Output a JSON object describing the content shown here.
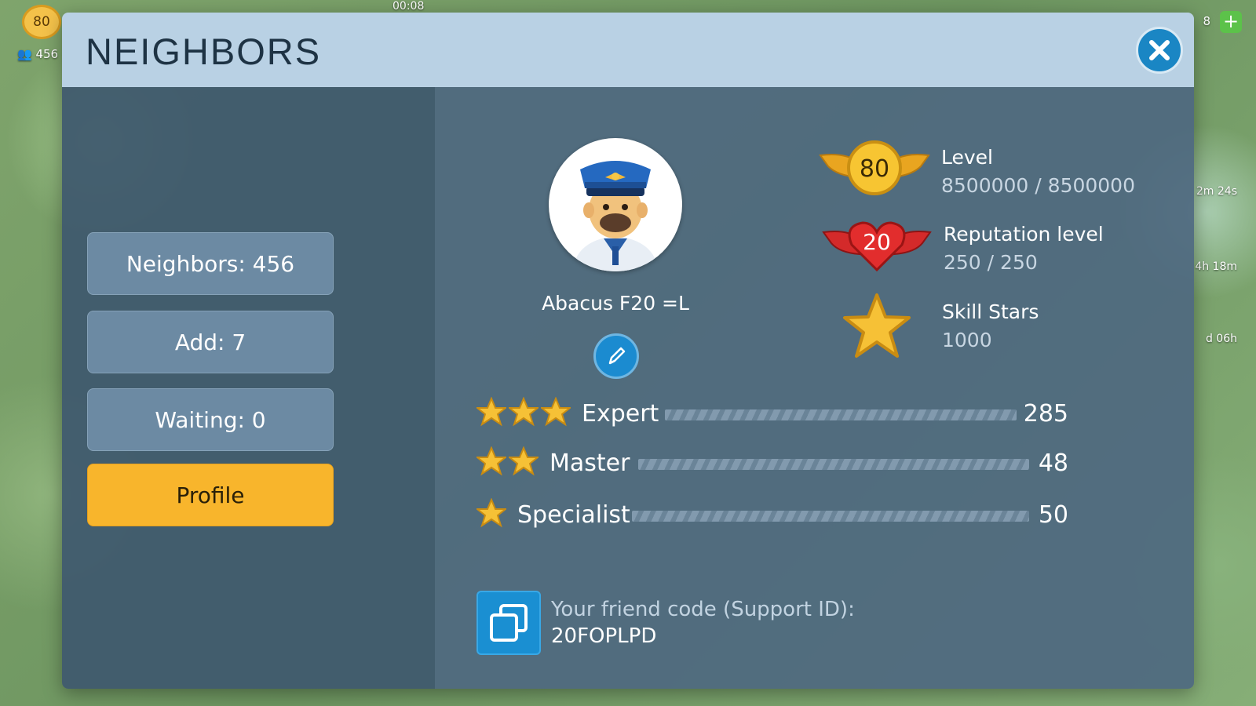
{
  "hud": {
    "level": "80",
    "population": "456",
    "time": "00:08",
    "right_counter": "8",
    "timers": [
      "2m 24s",
      "4h 18m",
      "d 06h"
    ]
  },
  "dialog": {
    "title": "NEIGHBORS",
    "close_icon": "close-icon"
  },
  "sidebar": {
    "items": [
      {
        "label": "Neighbors: 456",
        "active": false
      },
      {
        "label": "Add: 7",
        "active": false
      },
      {
        "label": "Waiting: 0",
        "active": false
      },
      {
        "label": "Profile",
        "active": true
      }
    ]
  },
  "profile": {
    "name": "Abacus F20 =L",
    "avatar_icon": "pilot-avatar",
    "edit_icon": "pencil-icon",
    "stats": [
      {
        "label": "Level",
        "value": "8500000 / 8500000",
        "badge": "80",
        "icon": "gold-wing-badge-icon"
      },
      {
        "label": "Reputation level",
        "value": "250 / 250",
        "badge": "20",
        "icon": "red-heart-wing-badge-icon"
      },
      {
        "label": "Skill Stars",
        "value": "1000",
        "icon": "gold-star-icon"
      }
    ],
    "ranks": [
      {
        "label": "Expert",
        "stars": 3,
        "count": "285"
      },
      {
        "label": "Master",
        "stars": 2,
        "count": "48"
      },
      {
        "label": "Specialist",
        "stars": 1,
        "count": "50"
      }
    ],
    "friend_code_label": "Your friend code (Support ID):",
    "friend_code": "20FOPLPD",
    "copy_icon": "copy-icon"
  },
  "colors": {
    "header": "#b9d1e4",
    "accent_button": "#f8b52c",
    "close_button": "#1a86c4"
  }
}
